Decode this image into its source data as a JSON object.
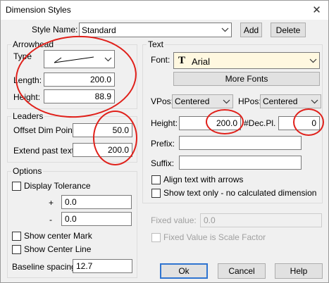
{
  "window": {
    "title": "Dimension Styles",
    "close_glyph": "✕"
  },
  "style_name": {
    "label": "Style Name:",
    "value": "Standard",
    "add_button": "Add",
    "delete_button": "Delete"
  },
  "arrowhead": {
    "group_title": "Arrowhead",
    "type_label": "Type",
    "length_label": "Length:",
    "length_value": "200.0",
    "height_label": "Height:",
    "height_value": "88.9"
  },
  "leaders": {
    "group_title": "Leaders",
    "offset_label": "Offset Dim Point:",
    "offset_value": "50.0",
    "extend_label": "Extend past text:",
    "extend_value": "200.0"
  },
  "options": {
    "group_title": "Options",
    "display_tolerance": "Display Tolerance",
    "plus_sign": "+",
    "plus_value": "0.0",
    "minus_sign": "-",
    "minus_value": "0.0",
    "show_center_mark": "Show center Mark",
    "show_center_line": "Show Center Line",
    "baseline_label": "Baseline spacing:",
    "baseline_value": "12.7"
  },
  "text": {
    "group_title": "Text",
    "font_label": "Font:",
    "font_icon_glyph": "T",
    "font_value": "Arial",
    "more_fonts_button": "More Fonts",
    "vpos_label": "VPos:",
    "vpos_value": "Centered",
    "hpos_label": "HPos:",
    "hpos_value": "Centered",
    "height_label": "Height:",
    "height_value": "200.0",
    "decpl_label": "#Dec.Pl.",
    "decpl_value": "0",
    "prefix_label": "Prefix:",
    "prefix_value": "",
    "suffix_label": "Suffix:",
    "suffix_value": "",
    "align_text": "Align text with arrows",
    "show_text_only": "Show text only - no calculated dimension"
  },
  "fixed": {
    "value_label": "Fixed value:",
    "value_placeholder": "0.0",
    "scale_factor_label": "Fixed Value is Scale Factor"
  },
  "buttons": {
    "ok": "Ok",
    "cancel": "Cancel",
    "help": "Help"
  },
  "colors": {
    "annotation_red": "#e0201a",
    "font_field_bg": "#fff8e0",
    "default_button_border": "#2f74d0"
  }
}
